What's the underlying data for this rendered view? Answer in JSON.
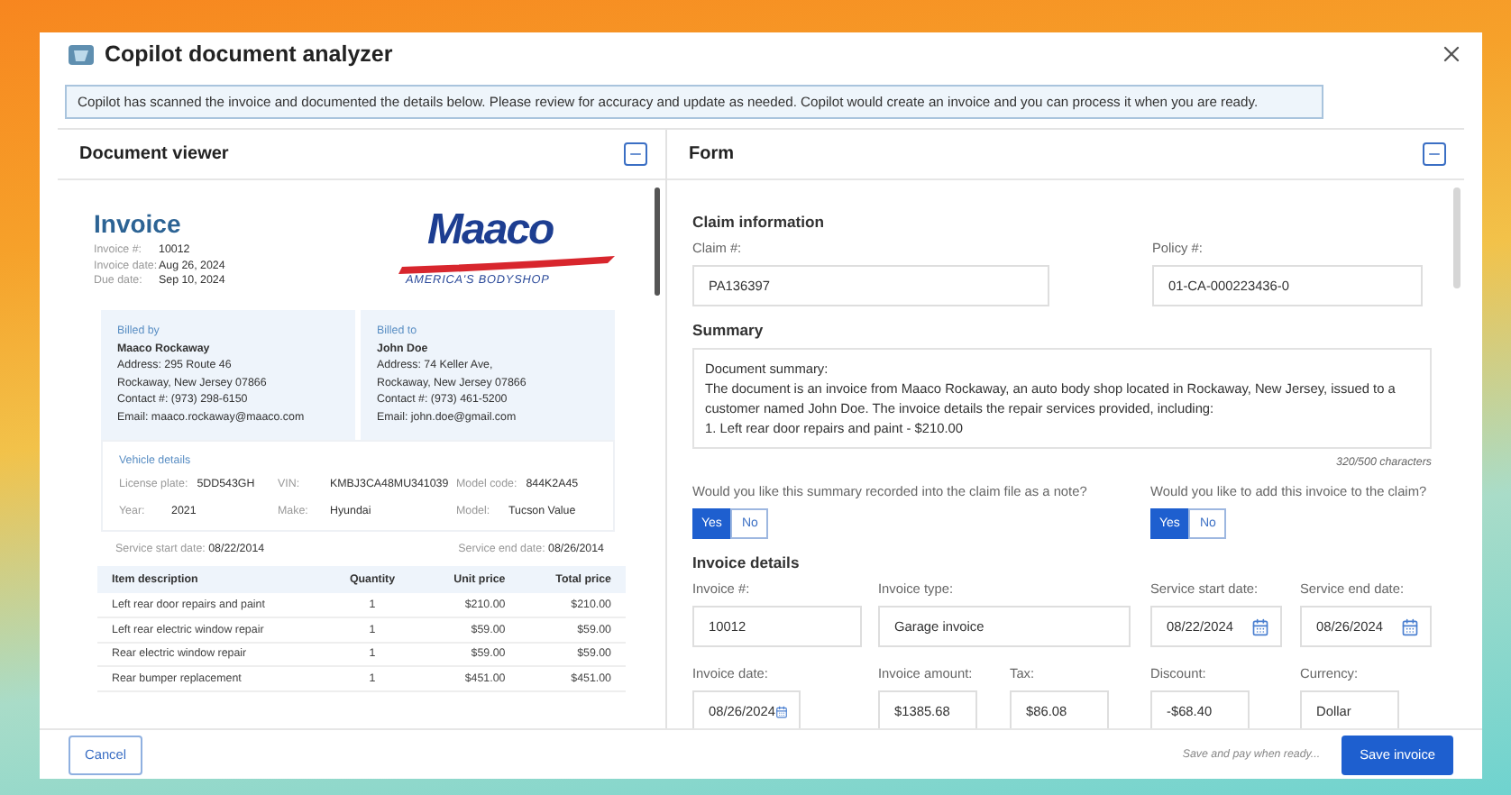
{
  "window": {
    "title": "Copilot document analyzer"
  },
  "banner": "Copilot has scanned the invoice and documented the details below. Please review for accuracy and update as needed. Copilot would create an invoice and you can process it when you are ready.",
  "document_viewer": {
    "title": "Document viewer",
    "invoice": {
      "title": "Invoice",
      "logo": {
        "name": "Maaco",
        "tagline": "AMERICA'S BODYSHOP"
      },
      "meta": [
        {
          "label": "Invoice #:",
          "value": "10012"
        },
        {
          "label": "Invoice date:",
          "value": "Aug 26, 2024"
        },
        {
          "label": "Due date:",
          "value": "Sep 10, 2024"
        }
      ],
      "parties": [
        {
          "heading": "Billed by",
          "name": "Maaco Rockaway",
          "lines": [
            "Address: 295 Route 46",
            "Rockaway, New Jersey 07866",
            "Contact #: (973) 298-6150",
            "Email: maaco.rockaway@maaco.com"
          ]
        },
        {
          "heading": "Billed to",
          "name": "John Doe",
          "lines": [
            "Address: 74 Keller Ave,",
            "Rockaway, New Jersey 07866",
            "Contact #: (973) 461-5200",
            "Email: john.doe@gmail.com"
          ]
        }
      ],
      "vehicle": {
        "heading": "Vehicle details",
        "fields": [
          {
            "label": "License plate:",
            "value": "5DD543GH"
          },
          {
            "label": "VIN:",
            "value": "KMBJ3CA48MU341039"
          },
          {
            "label": "Model code:",
            "value": "844K2A45"
          },
          {
            "label": "Year:",
            "value": "2021"
          },
          {
            "label": "Make:",
            "value": "Hyundai"
          },
          {
            "label": "Model:",
            "value": "Tucson Value"
          }
        ]
      },
      "service": [
        {
          "label": "Service start date:",
          "value": "08/22/2014"
        },
        {
          "label": "Service end date:",
          "value": "08/26/2014"
        }
      ],
      "table": {
        "columns": [
          "Item description",
          "Quantity",
          "Unit price",
          "Total price"
        ],
        "rows": [
          [
            "Left rear door repairs and paint",
            "1",
            "$210.00",
            "$210.00"
          ],
          [
            "Left rear electric window repair",
            "1",
            "$59.00",
            "$59.00"
          ],
          [
            "Rear electric window repair",
            "1",
            "$59.00",
            "$59.00"
          ],
          [
            "Rear bumper replacement",
            "1",
            "$451.00",
            "$451.00"
          ]
        ]
      }
    }
  },
  "form": {
    "title": "Form",
    "claim": {
      "heading": "Claim information",
      "fields": [
        {
          "label": "Claim #:",
          "value": "PA136397"
        },
        {
          "label": "Policy #:",
          "value": "01-CA-000223436-0"
        }
      ]
    },
    "summary": {
      "heading": "Summary",
      "lines": [
        "Document summary:",
        "The document is an invoice from Maaco Rockaway, an auto body shop located in Rockaway, New Jersey, issued to a customer named John Doe. The invoice details the repair services provided, including:",
        "1. Left rear door repairs and paint - $210.00"
      ],
      "count": "320/500 characters"
    },
    "questions": [
      {
        "text": "Would you like this summary recorded into the claim file as a note?",
        "options": [
          {
            "label": "Yes",
            "selected": true
          },
          {
            "label": "No",
            "selected": false
          }
        ]
      },
      {
        "text": "Would you like to add this invoice to the claim?",
        "options": [
          {
            "label": "Yes",
            "selected": true
          },
          {
            "label": "No",
            "selected": false
          }
        ]
      }
    ],
    "invoice": {
      "heading": "Invoice details",
      "fields": [
        {
          "label": "Invoice #:",
          "value": "10012",
          "kind": "text"
        },
        {
          "label": "Invoice type:",
          "value": "Garage invoice",
          "kind": "text"
        },
        {
          "label": "Service start date:",
          "value": "08/22/2024",
          "kind": "date"
        },
        {
          "label": "Service end date:",
          "value": "08/26/2024",
          "kind": "date"
        },
        {
          "label": "Invoice date:",
          "value": "08/26/2024",
          "kind": "date"
        },
        {
          "label": "Invoice amount:",
          "value": "$1385.68",
          "kind": "text"
        },
        {
          "label": "Tax:",
          "value": "$86.08",
          "kind": "text"
        },
        {
          "label": "Discount:",
          "value": "-$68.40",
          "kind": "text"
        },
        {
          "label": "Currency:",
          "value": "Dollar",
          "kind": "text"
        }
      ]
    }
  },
  "footer": {
    "cancel": "Cancel",
    "hint": "Save and pay when ready...",
    "save": "Save invoice"
  }
}
